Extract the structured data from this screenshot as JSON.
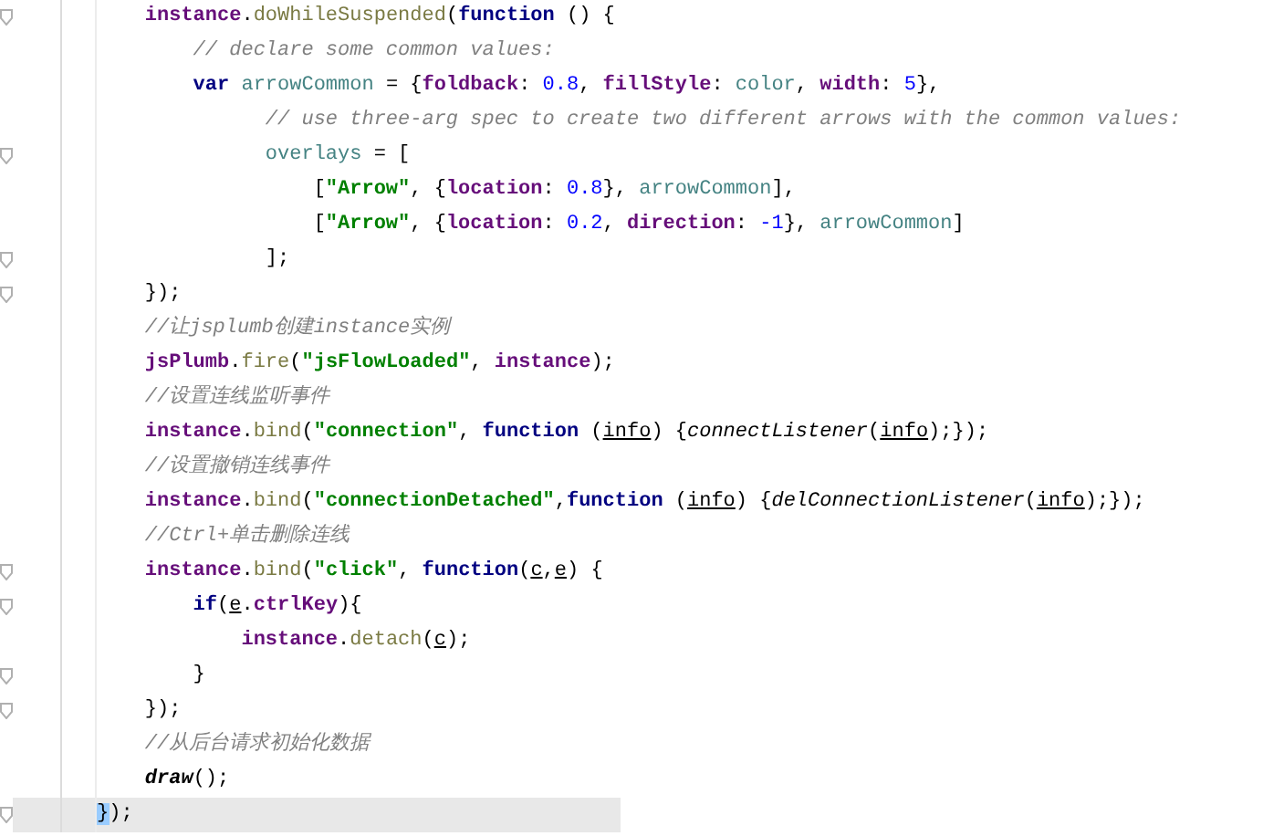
{
  "editor": {
    "lines": [
      {
        "fold": true,
        "current": false,
        "tokens": [
          {
            "kind": "global",
            "text": "    instance"
          },
          {
            "kind": "plain",
            "text": "."
          },
          {
            "kind": "method",
            "text": "doWhileSuspended"
          },
          {
            "kind": "plain",
            "text": "("
          },
          {
            "kind": "keyword",
            "text": "function"
          },
          {
            "kind": "plain",
            "text": " () {"
          }
        ]
      },
      {
        "fold": false,
        "current": false,
        "tokens": [
          {
            "kind": "comment",
            "text": "        // declare some common values:"
          }
        ]
      },
      {
        "fold": false,
        "current": false,
        "tokens": [
          {
            "kind": "keyword",
            "text": "        var "
          },
          {
            "kind": "local",
            "text": "arrowCommon"
          },
          {
            "kind": "plain",
            "text": " = {"
          },
          {
            "kind": "prop",
            "text": "foldback"
          },
          {
            "kind": "plain",
            "text": ": "
          },
          {
            "kind": "number",
            "text": "0.8"
          },
          {
            "kind": "plain",
            "text": ", "
          },
          {
            "kind": "prop",
            "text": "fillStyle"
          },
          {
            "kind": "plain",
            "text": ": "
          },
          {
            "kind": "local",
            "text": "color"
          },
          {
            "kind": "plain",
            "text": ", "
          },
          {
            "kind": "prop",
            "text": "width"
          },
          {
            "kind": "plain",
            "text": ": "
          },
          {
            "kind": "number",
            "text": "5"
          },
          {
            "kind": "plain",
            "text": "},"
          }
        ]
      },
      {
        "fold": false,
        "current": false,
        "tokens": [
          {
            "kind": "comment",
            "text": "              // use three-arg spec to create two different arrows with the common values:"
          }
        ]
      },
      {
        "fold": true,
        "current": false,
        "tokens": [
          {
            "kind": "local",
            "text": "              overlays"
          },
          {
            "kind": "plain",
            "text": " = ["
          }
        ]
      },
      {
        "fold": false,
        "current": false,
        "tokens": [
          {
            "kind": "plain",
            "text": "                  ["
          },
          {
            "kind": "string",
            "text": "\"Arrow\""
          },
          {
            "kind": "plain",
            "text": ", {"
          },
          {
            "kind": "prop",
            "text": "location"
          },
          {
            "kind": "plain",
            "text": ": "
          },
          {
            "kind": "number",
            "text": "0.8"
          },
          {
            "kind": "plain",
            "text": "}, "
          },
          {
            "kind": "local",
            "text": "arrowCommon"
          },
          {
            "kind": "plain",
            "text": "],"
          }
        ]
      },
      {
        "fold": false,
        "current": false,
        "tokens": [
          {
            "kind": "plain",
            "text": "                  ["
          },
          {
            "kind": "string",
            "text": "\"Arrow\""
          },
          {
            "kind": "plain",
            "text": ", {"
          },
          {
            "kind": "prop",
            "text": "location"
          },
          {
            "kind": "plain",
            "text": ": "
          },
          {
            "kind": "number",
            "text": "0.2"
          },
          {
            "kind": "plain",
            "text": ", "
          },
          {
            "kind": "prop",
            "text": "direction"
          },
          {
            "kind": "plain",
            "text": ": "
          },
          {
            "kind": "number",
            "text": "-1"
          },
          {
            "kind": "plain",
            "text": "}, "
          },
          {
            "kind": "local",
            "text": "arrowCommon"
          },
          {
            "kind": "plain",
            "text": "]"
          }
        ]
      },
      {
        "fold": true,
        "current": false,
        "tokens": [
          {
            "kind": "plain",
            "text": "              ];"
          }
        ]
      },
      {
        "fold": true,
        "current": false,
        "tokens": [
          {
            "kind": "plain",
            "text": "    });"
          }
        ]
      },
      {
        "fold": false,
        "current": false,
        "tokens": [
          {
            "kind": "comment",
            "text": "    //让jsplumb创建instance实例"
          }
        ]
      },
      {
        "fold": false,
        "current": false,
        "tokens": [
          {
            "kind": "global",
            "text": "    jsPlumb"
          },
          {
            "kind": "plain",
            "text": "."
          },
          {
            "kind": "method",
            "text": "fire"
          },
          {
            "kind": "plain",
            "text": "("
          },
          {
            "kind": "string",
            "text": "\"jsFlowLoaded\""
          },
          {
            "kind": "plain",
            "text": ", "
          },
          {
            "kind": "global",
            "text": "instance"
          },
          {
            "kind": "plain",
            "text": ");"
          }
        ]
      },
      {
        "fold": false,
        "current": false,
        "tokens": [
          {
            "kind": "comment",
            "text": "    //设置连线监听事件"
          }
        ]
      },
      {
        "fold": false,
        "current": false,
        "tokens": [
          {
            "kind": "global",
            "text": "    instance"
          },
          {
            "kind": "plain",
            "text": "."
          },
          {
            "kind": "method",
            "text": "bind"
          },
          {
            "kind": "plain",
            "text": "("
          },
          {
            "kind": "string",
            "text": "\"connection\""
          },
          {
            "kind": "plain",
            "text": ", "
          },
          {
            "kind": "keyword",
            "text": "function"
          },
          {
            "kind": "plain",
            "text": " ("
          },
          {
            "kind": "param",
            "text": "info"
          },
          {
            "kind": "plain",
            "text": ") {"
          },
          {
            "kind": "call",
            "text": "connectListener"
          },
          {
            "kind": "plain",
            "text": "("
          },
          {
            "kind": "param",
            "text": "info"
          },
          {
            "kind": "plain",
            "text": ");});"
          }
        ]
      },
      {
        "fold": false,
        "current": false,
        "tokens": [
          {
            "kind": "comment",
            "text": "    //设置撤销连线事件"
          }
        ]
      },
      {
        "fold": false,
        "current": false,
        "tokens": [
          {
            "kind": "global",
            "text": "    instance"
          },
          {
            "kind": "plain",
            "text": "."
          },
          {
            "kind": "method",
            "text": "bind"
          },
          {
            "kind": "plain",
            "text": "("
          },
          {
            "kind": "string",
            "text": "\"connectionDetached\""
          },
          {
            "kind": "plain",
            "text": ","
          },
          {
            "kind": "keyword",
            "text": "function"
          },
          {
            "kind": "plain",
            "text": " ("
          },
          {
            "kind": "param",
            "text": "info"
          },
          {
            "kind": "plain",
            "text": ") {"
          },
          {
            "kind": "call",
            "text": "delConnectionListener"
          },
          {
            "kind": "plain",
            "text": "("
          },
          {
            "kind": "param",
            "text": "info"
          },
          {
            "kind": "plain",
            "text": ");});"
          }
        ]
      },
      {
        "fold": false,
        "current": false,
        "tokens": [
          {
            "kind": "comment",
            "text": "    //Ctrl+单击删除连线"
          }
        ]
      },
      {
        "fold": true,
        "current": false,
        "tokens": [
          {
            "kind": "global",
            "text": "    instance"
          },
          {
            "kind": "plain",
            "text": "."
          },
          {
            "kind": "method",
            "text": "bind"
          },
          {
            "kind": "plain",
            "text": "("
          },
          {
            "kind": "string",
            "text": "\"click\""
          },
          {
            "kind": "plain",
            "text": ", "
          },
          {
            "kind": "keyword",
            "text": "function"
          },
          {
            "kind": "plain",
            "text": "("
          },
          {
            "kind": "param",
            "text": "c"
          },
          {
            "kind": "plain",
            "text": ","
          },
          {
            "kind": "param",
            "text": "e"
          },
          {
            "kind": "plain",
            "text": ") {"
          }
        ]
      },
      {
        "fold": true,
        "current": false,
        "tokens": [
          {
            "kind": "keyword",
            "text": "        if"
          },
          {
            "kind": "plain",
            "text": "("
          },
          {
            "kind": "param",
            "text": "e"
          },
          {
            "kind": "plain",
            "text": "."
          },
          {
            "kind": "prop",
            "text": "ctrlKey"
          },
          {
            "kind": "plain",
            "text": "){"
          }
        ]
      },
      {
        "fold": false,
        "current": false,
        "tokens": [
          {
            "kind": "global",
            "text": "            instance"
          },
          {
            "kind": "plain",
            "text": "."
          },
          {
            "kind": "method",
            "text": "detach"
          },
          {
            "kind": "plain",
            "text": "("
          },
          {
            "kind": "param",
            "text": "c"
          },
          {
            "kind": "plain",
            "text": ");"
          }
        ]
      },
      {
        "fold": true,
        "current": false,
        "tokens": [
          {
            "kind": "plain",
            "text": "        }"
          }
        ]
      },
      {
        "fold": true,
        "current": false,
        "tokens": [
          {
            "kind": "plain",
            "text": "    });"
          }
        ]
      },
      {
        "fold": false,
        "current": false,
        "tokens": [
          {
            "kind": "comment",
            "text": "    //从后台请求初始化数据"
          }
        ]
      },
      {
        "fold": false,
        "current": false,
        "tokens": [
          {
            "kind": "func",
            "text": "    draw"
          },
          {
            "kind": "plain",
            "text": "();"
          }
        ]
      },
      {
        "fold": true,
        "current": true,
        "tokens": [
          {
            "kind": "match",
            "text": "}"
          },
          {
            "kind": "plain",
            "text": ");"
          }
        ]
      }
    ]
  }
}
